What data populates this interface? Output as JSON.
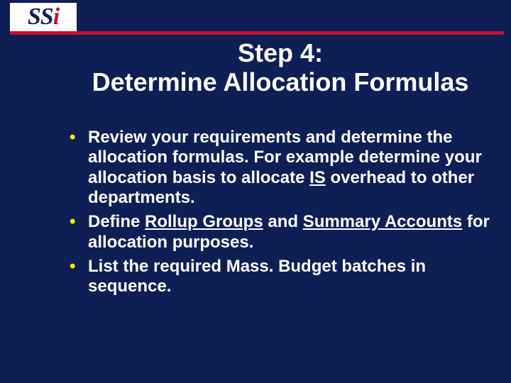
{
  "logo": {
    "part1": "SS",
    "part2": "i"
  },
  "title": {
    "line1": "Step 4:",
    "line2": "Determine Allocation Formulas"
  },
  "bullets": {
    "b1": {
      "pre": "Review your requirements and determine the allocation formulas.  For example determine your allocation basis to allocate ",
      "u1": "IS",
      "post": " overhead to other departments."
    },
    "b2": {
      "pre": "Define ",
      "u1": "Rollup Groups",
      "mid": " and ",
      "u2": "Summary Accounts",
      "post": " for allocation purposes."
    },
    "b3": {
      "text": "List the required Mass. Budget batches in sequence."
    }
  },
  "marker": "•"
}
